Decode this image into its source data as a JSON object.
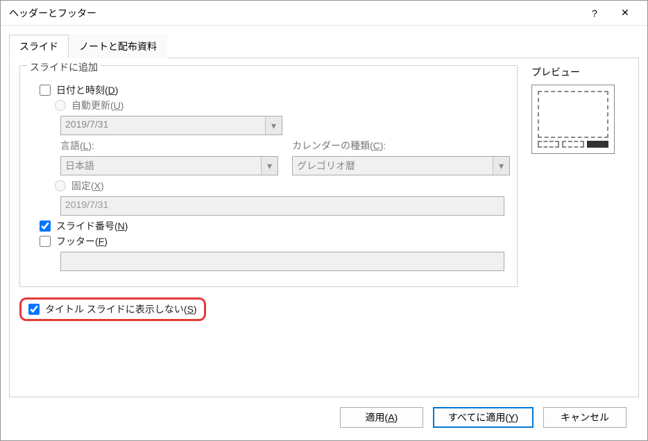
{
  "title": "ヘッダーとフッター",
  "help_icon": "?",
  "close_icon": "✕",
  "tabs": {
    "slide": "スライド",
    "notes": "ノートと配布資料"
  },
  "fieldset": {
    "legend": "スライドに追加"
  },
  "datetime": {
    "label": "日付と時刻(",
    "key": "D",
    "label_end": ")",
    "auto": {
      "label": "自動更新(",
      "key": "U",
      "label_end": ")",
      "date_value": "2019/7/31",
      "lang_label": "言語(",
      "lang_key": "L",
      "lang_end": "):",
      "lang_value": "日本語",
      "cal_label": "カレンダーの種類(",
      "cal_key": "C",
      "cal_end": "):",
      "cal_value": "グレゴリオ暦"
    },
    "fixed": {
      "label": "固定(",
      "key": "X",
      "label_end": ")",
      "value": "2019/7/31"
    }
  },
  "slidenum": {
    "label": "スライド番号(",
    "key": "N",
    "label_end": ")"
  },
  "footer": {
    "label": "フッター(",
    "key": "F",
    "label_end": ")",
    "value": ""
  },
  "notitle": {
    "label": "タイトル スライドに表示しない(",
    "key": "S",
    "label_end": ")"
  },
  "preview": {
    "label": "プレビュー"
  },
  "buttons": {
    "apply": "適用(",
    "apply_key": "A",
    "apply_end": ")",
    "applyall": "すべてに適用(",
    "applyall_key": "Y",
    "applyall_end": ")",
    "cancel": "キャンセル"
  }
}
